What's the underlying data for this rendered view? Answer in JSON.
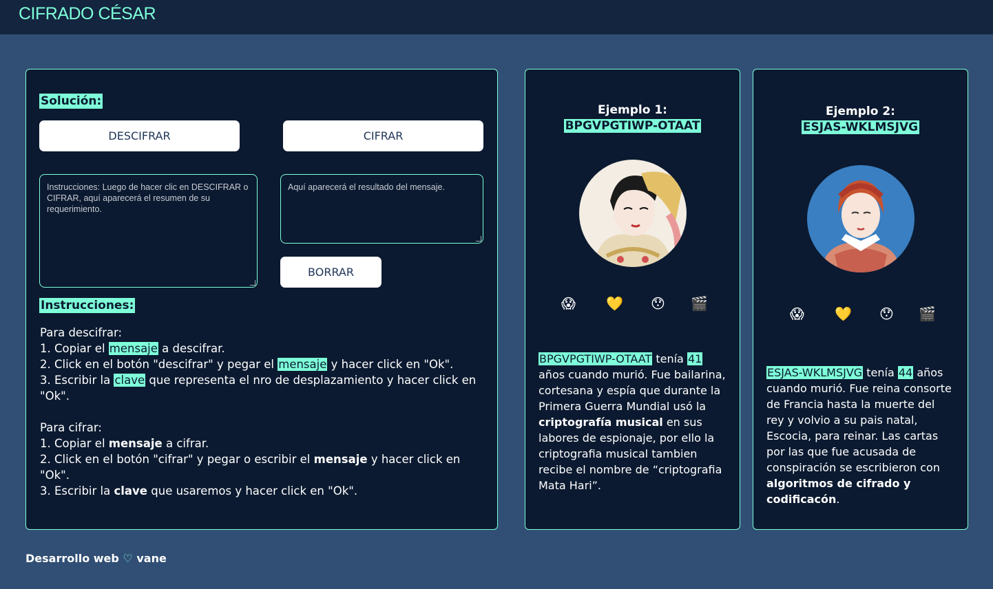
{
  "header": {
    "title": "CIFRADO CÉSAR"
  },
  "solution": {
    "heading": "Solución:",
    "decrypt_label": "DESCIFRAR",
    "encrypt_label": "CIFRAR",
    "input_placeholder": "Instrucciones: Luego de hacer clic en DESCIFRAR o CIFRAR, aquí aparecerá el resumen de su requerimiento.",
    "output_placeholder": "Aquí aparecerá el resultado del mensaje.",
    "clear_label": "BORRAR"
  },
  "instructions": {
    "heading": "Instrucciones:",
    "decrypt_title": "Para descifrar:",
    "d1_a": "1. Copiar el ",
    "d1_hl": "mensaje",
    "d1_b": " a descifrar.",
    "d2_a": "2. Click en el botón \"descifrar\" y pegar el ",
    "d2_hl": "mensaje",
    "d2_b": " y hacer click en \"Ok\".",
    "d3_a": "3. Escribir la ",
    "d3_hl": "clave",
    "d3_b": " que representa el nro de desplazamiento y hacer click en \"Ok\".",
    "encrypt_title": "Para cifrar:",
    "e1_a": "1. Copiar el ",
    "e1_b": "mensaje",
    "e1_c": " a cifrar.",
    "e2_a": "2. Click en el botón \"cifrar\" y pegar o escribir el ",
    "e2_b": "mensaje",
    "e2_c": " y hacer click en \"Ok\".",
    "e3_a": "3. Escribir la ",
    "e3_b": "clave",
    "e3_c": " que usaremos y hacer click en \"Ok\"."
  },
  "example1": {
    "title": "Ejemplo 1:",
    "code": "BPGVPGTIWP-OTAAT",
    "emojis": [
      "😱",
      "💛",
      "😯",
      "🎬"
    ],
    "text_code": "BPGVPGTIWP-OTAAT",
    "text_a": " tenía ",
    "age": "41",
    "text_b": " años cuando murió. Fue bailarina, cortesana y espía que durante la Primera Guerra Mundial usó la ",
    "text_bold": "criptografía musical",
    "text_c": " en sus labores de espionaje, por ello la criptografia musical tambien recibe el nombre de “criptografia Mata Hari”."
  },
  "example2": {
    "title": "Ejemplo 2:",
    "code": "ESJAS-WKLMSJVG",
    "emojis": [
      "😱",
      "💛",
      "😯",
      "🎬"
    ],
    "text_code": "ESJAS-WKLMSJVG",
    "text_a": " tenía ",
    "age": "44",
    "text_b": " años cuando murió. Fue reina consorte de Francia hasta la muerte del rey y volvio a su pais natal, Escocia, para reinar. Las cartas por las que fue acusada de conspiración se escribieron con ",
    "text_bold": "algoritmos de cifrado y codificacón",
    "text_c": "."
  },
  "footer": {
    "text_a": "Desarrollo web ",
    "heart": "♡",
    "text_b": " vane"
  }
}
